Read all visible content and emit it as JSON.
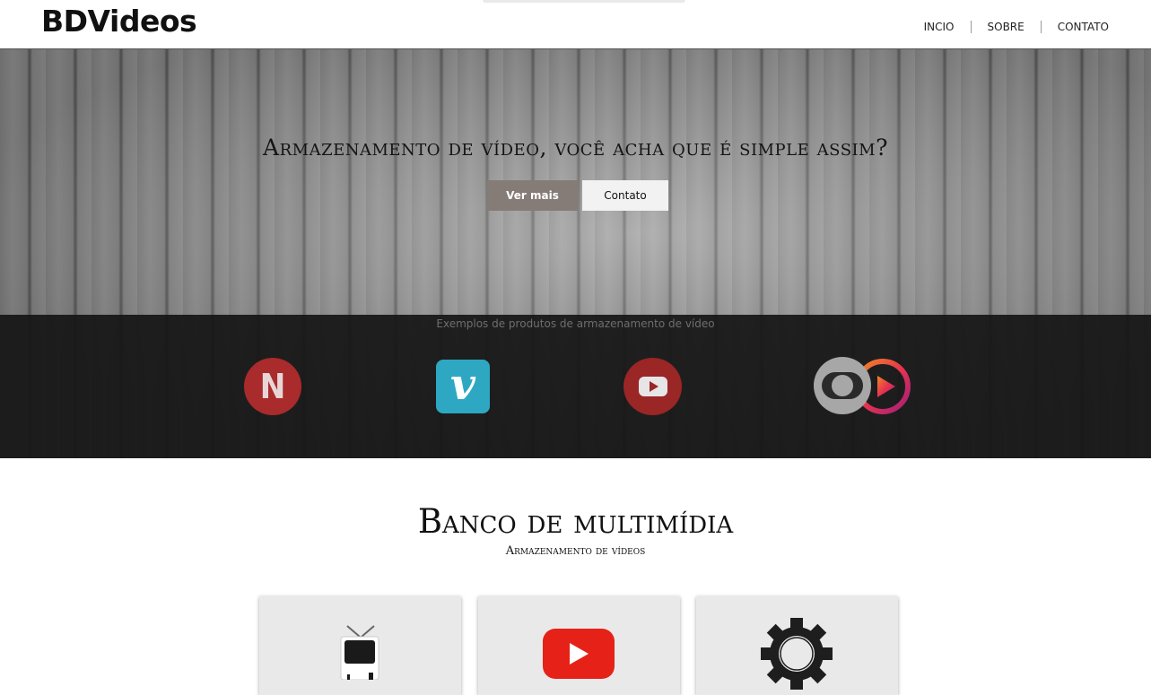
{
  "header": {
    "logo": "BDVideos",
    "nav": [
      "INCIO",
      "SOBRE",
      "CONTATO"
    ]
  },
  "hero": {
    "title": "Armazenamento de vídeo, você acha que é simple assim?",
    "buttons": {
      "more": "Ver mais",
      "contact": "Contato"
    },
    "examples_caption": "Exemplos de produtos de armazenamento de vídeo",
    "brands": [
      {
        "icon": "netflix-icon",
        "letter": "N",
        "color": "#a92b2b"
      },
      {
        "icon": "vimeo-icon",
        "letter": "v",
        "color": "#2ea8c2"
      },
      {
        "icon": "youtube-icon",
        "color": "#9b2626"
      },
      {
        "icon": "globoplay-icon"
      }
    ]
  },
  "section": {
    "title": "Banco de multimídia",
    "subtitle": "Armazenamento de vídeos",
    "cards": [
      {
        "icon": "tv-icon"
      },
      {
        "icon": "youtube-play-icon",
        "color": "#e62117"
      },
      {
        "icon": "gear-icon"
      }
    ]
  }
}
